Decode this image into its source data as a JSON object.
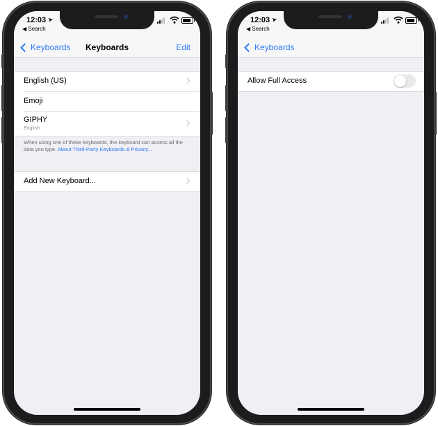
{
  "left_phone": {
    "status": {
      "time": "12:03",
      "back_app": "◀ Search"
    },
    "nav": {
      "back_label": "Keyboards",
      "title": "Keyboards",
      "edit_label": "Edit"
    },
    "keyboards": [
      {
        "label": "English (US)",
        "sub": ""
      },
      {
        "label": "Emoji",
        "sub": ""
      },
      {
        "label": "GIPHY",
        "sub": "English"
      }
    ],
    "note": {
      "text": "When using one of these keyboards, the keyboard can access all the data you type. ",
      "link": "About Third-Party Keyboards & Privacy..."
    },
    "add_new_label": "Add New Keyboard..."
  },
  "right_phone": {
    "status": {
      "time": "12:03",
      "back_app": "◀ Search"
    },
    "nav": {
      "back_label": "Keyboards"
    },
    "allow_full_access": {
      "label": "Allow Full Access",
      "enabled": false
    }
  },
  "colors": {
    "accent": "#2f7bf6",
    "background": "#efeff4",
    "toggle_off": "#e9e9eb"
  },
  "icons": [
    "location-arrow-icon",
    "signal-icon",
    "wifi-icon",
    "battery-icon",
    "chevron-left-icon",
    "chevron-right-icon"
  ]
}
